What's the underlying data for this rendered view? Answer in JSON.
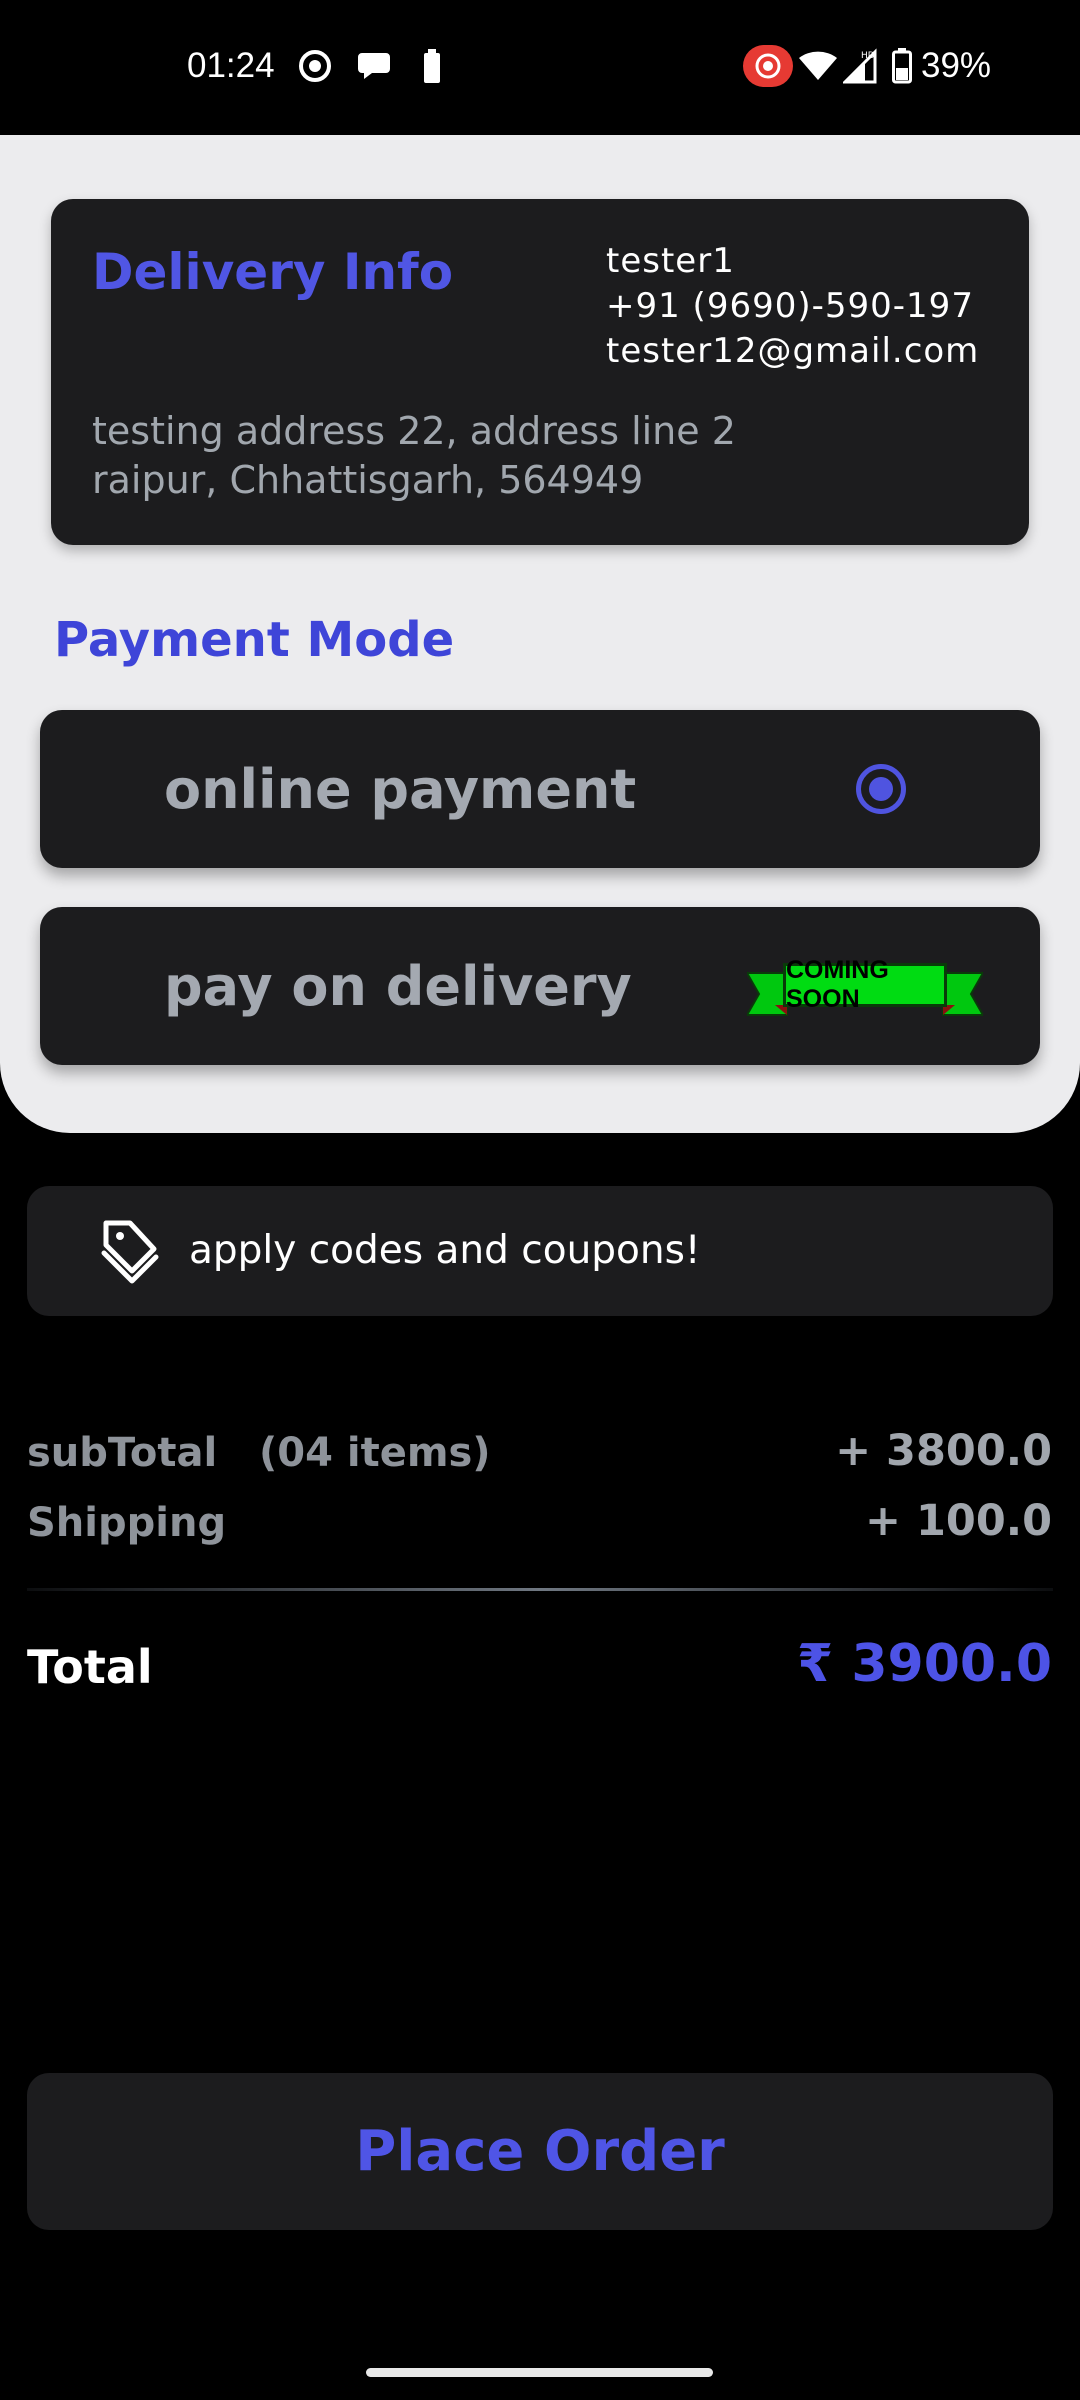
{
  "status_bar": {
    "time": "01:24",
    "battery_percent": "39%",
    "icons": [
      "record-icon",
      "chat-bubble-icon",
      "battery-small-icon",
      "screen-record-icon",
      "wifi-icon",
      "signal-icon",
      "battery-icon"
    ]
  },
  "delivery": {
    "title": "Delivery Info",
    "name": "tester1",
    "phone": "+91 (9690)-590-197",
    "email": "tester12@gmail.com",
    "address_line1": "testing address 22, address line 2",
    "address_line2": "raipur, Chhattisgarh, 564949"
  },
  "payment": {
    "title": "Payment Mode",
    "options": [
      {
        "label": "online payment",
        "selected": true
      },
      {
        "label": "pay on delivery",
        "badge": "COMING SOON"
      }
    ]
  },
  "coupon": {
    "label": "apply codes and coupons!",
    "icon": "tag-icon"
  },
  "summary": {
    "subtotal_label": "subTotal",
    "items_count": "(04 items)",
    "subtotal_value": "+ 3800.0",
    "shipping_label": "Shipping",
    "shipping_value": "+ 100.0",
    "total_label": "Total",
    "total_value": "₹ 3900.0"
  },
  "actions": {
    "place_order": "Place Order"
  },
  "colors": {
    "accent": "#4f55e6",
    "card": "#1c1c1e",
    "sheet": "#ececee",
    "badge_green": "#00dc12"
  }
}
